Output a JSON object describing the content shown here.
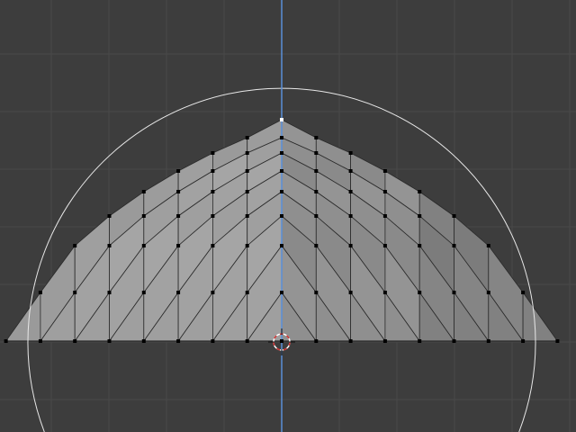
{
  "viewport": {
    "colors": {
      "background": "#3d3d3d",
      "grid": "#494949",
      "axis_z": "#5a8fd8",
      "mesh_light": "#a8a8a8",
      "mesh_dark": "#6e6e6e",
      "edge": "#2a2a2a",
      "vertex": "#000000",
      "active_vertex": "#ffffff",
      "brush_circle": "#e8e8e8",
      "cursor_red": "#d03030"
    }
  }
}
